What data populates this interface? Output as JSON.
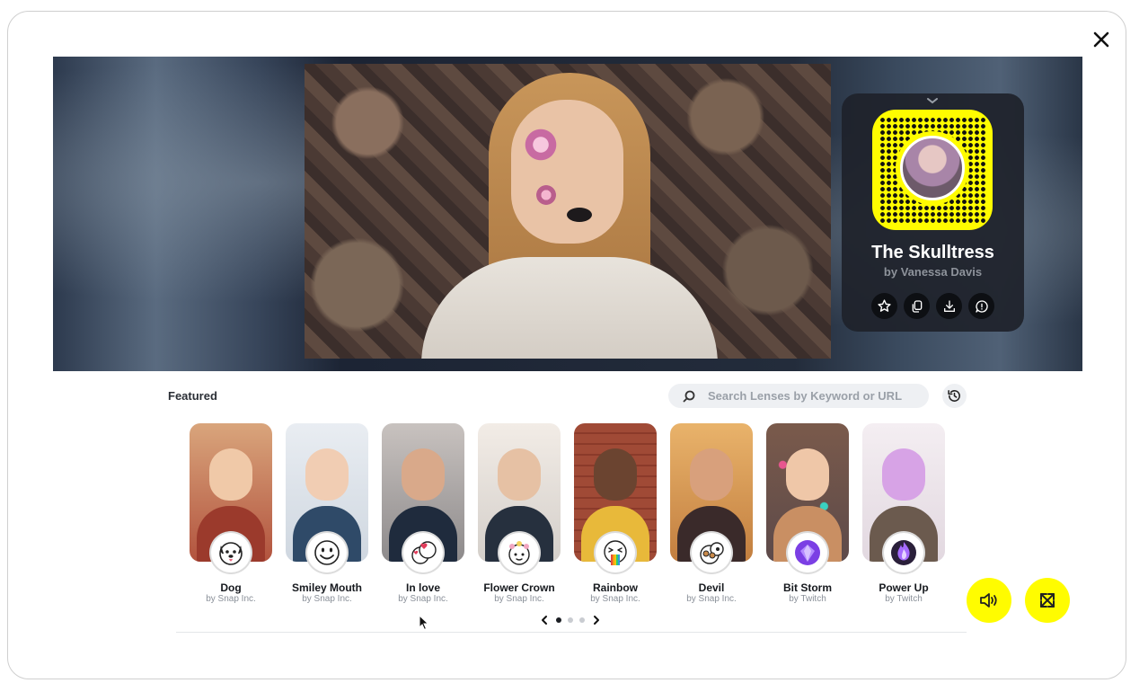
{
  "modal": {
    "close_icon": "close-icon"
  },
  "preview": {
    "lens": {
      "title": "The Skulltress",
      "author": "by Vanessa Davis"
    },
    "actions": [
      {
        "name": "favorite-icon"
      },
      {
        "name": "copy-icon"
      },
      {
        "name": "download-icon"
      },
      {
        "name": "report-icon"
      }
    ]
  },
  "browser": {
    "section_title": "Featured",
    "search": {
      "placeholder": "Search Lenses by Keyword or URL",
      "value": ""
    },
    "lenses": [
      {
        "name": "Dog",
        "by": "by Snap Inc.",
        "icon": "dog-icon"
      },
      {
        "name": "Smiley Mouth",
        "by": "by Snap Inc.",
        "icon": "smiley-icon"
      },
      {
        "name": "In love",
        "by": "by Snap Inc.",
        "icon": "in-love-icon"
      },
      {
        "name": "Flower Crown",
        "by": "by Snap Inc.",
        "icon": "flower-crown-icon"
      },
      {
        "name": "Rainbow",
        "by": "by Snap Inc.",
        "icon": "rainbow-icon"
      },
      {
        "name": "Devil",
        "by": "by Snap Inc.",
        "icon": "devil-icon"
      },
      {
        "name": "Bit Storm",
        "by": "by Twitch",
        "icon": "bit-storm-icon"
      },
      {
        "name": "Power Up",
        "by": "by Twitch",
        "icon": "power-up-icon"
      }
    ],
    "pager": {
      "pages": 3,
      "current": 1
    }
  },
  "colors": {
    "accent": "#fffc00",
    "card_bg": "#1e222a",
    "text_dark": "#16191e",
    "text_muted": "#8a9099"
  }
}
